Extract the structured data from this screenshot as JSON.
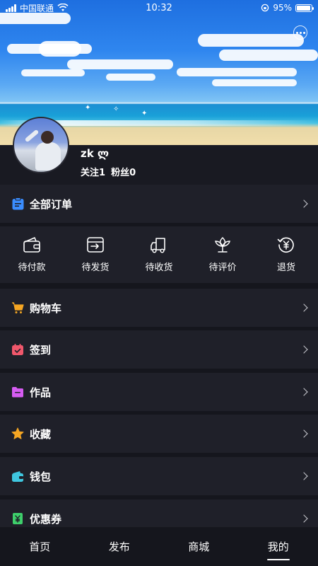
{
  "status_bar": {
    "carrier": "中国联通",
    "time": "10:32",
    "battery": "95%",
    "battery_level": 0.95
  },
  "profile": {
    "username": "zk ლ",
    "following_label": "关注",
    "following_count": "1",
    "fans_label": "粉丝",
    "fans_count": "0"
  },
  "orders_row": {
    "label": "全部订单"
  },
  "order_items": [
    {
      "label": "待付款",
      "icon": "wallet-icon"
    },
    {
      "label": "待发货",
      "icon": "package-out-icon"
    },
    {
      "label": "待收货",
      "icon": "truck-icon"
    },
    {
      "label": "待评价",
      "icon": "flower-icon"
    },
    {
      "label": "退货",
      "icon": "yen-refund-icon"
    }
  ],
  "menu": [
    {
      "label": "购物车",
      "icon": "cart-icon",
      "color": "#f5a623"
    },
    {
      "label": "签到",
      "icon": "calendar-icon",
      "color": "#f0576b"
    },
    {
      "label": "作品",
      "icon": "folder-icon",
      "color": "#d65cf2"
    },
    {
      "label": "收藏",
      "icon": "star-icon",
      "color": "#f5a623"
    },
    {
      "label": "钱包",
      "icon": "wallet-icon",
      "color": "#3fc7e0"
    },
    {
      "label": "优惠券",
      "icon": "coupon-icon",
      "color": "#3ecf6b"
    }
  ],
  "tabs": [
    {
      "label": "首页"
    },
    {
      "label": "发布"
    },
    {
      "label": "商城"
    },
    {
      "label": "我的",
      "active": true
    }
  ],
  "colors": {
    "background": "#15161d",
    "card": "#1f2029",
    "orders_icon": "#3a8dff"
  }
}
